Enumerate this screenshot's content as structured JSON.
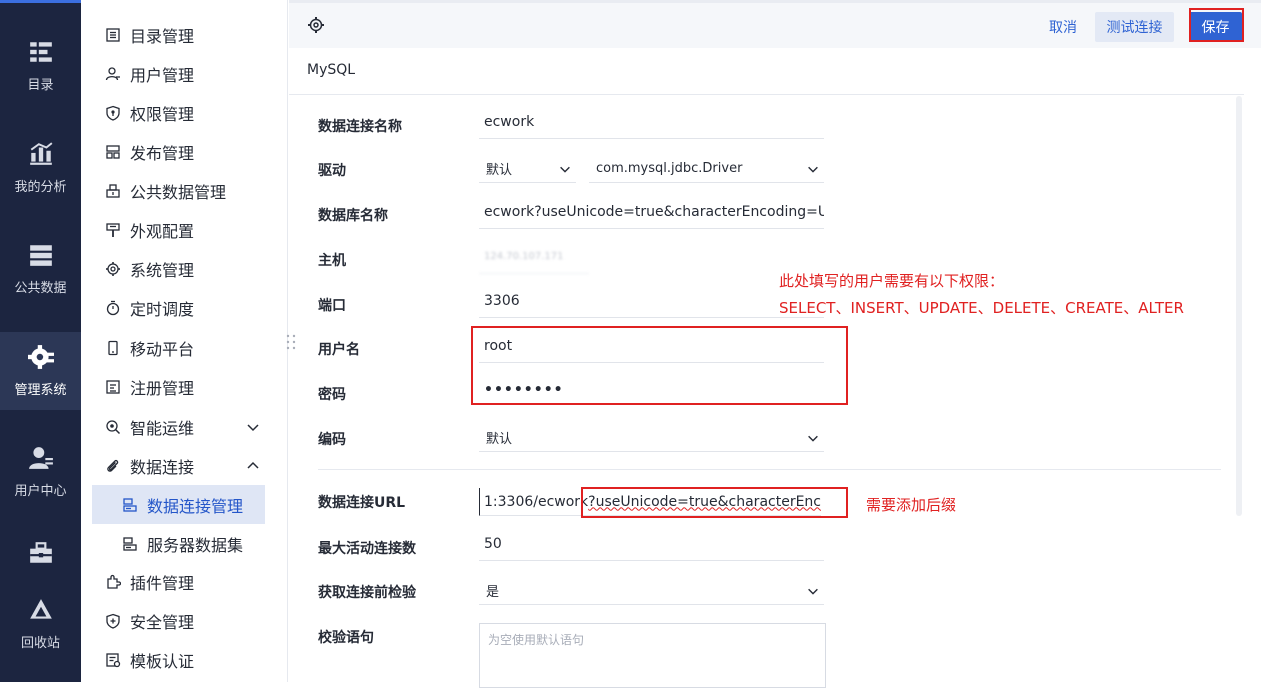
{
  "rail": {
    "items": [
      {
        "label": "目录",
        "icon": "catalog-icon"
      },
      {
        "label": "我的分析",
        "icon": "analysis-icon"
      },
      {
        "label": "公共数据",
        "icon": "public-data-icon"
      },
      {
        "label": "管理系统",
        "icon": "management-gear-icon",
        "active": true
      },
      {
        "label": "用户中心",
        "icon": "user-center-icon"
      },
      {
        "label": "",
        "icon": "toolbox-icon"
      },
      {
        "label": "回收站",
        "icon": "recycle-icon"
      }
    ]
  },
  "menu": {
    "items": [
      {
        "label": "目录管理",
        "icon": "catalog-manage-icon"
      },
      {
        "label": "用户管理",
        "icon": "user-manage-icon"
      },
      {
        "label": "权限管理",
        "icon": "permission-icon"
      },
      {
        "label": "发布管理",
        "icon": "publish-icon"
      },
      {
        "label": "公共数据管理",
        "icon": "public-data-manage-icon"
      },
      {
        "label": "外观配置",
        "icon": "appearance-icon"
      },
      {
        "label": "系统管理",
        "icon": "system-gear-icon"
      },
      {
        "label": "定时调度",
        "icon": "timer-icon"
      },
      {
        "label": "移动平台",
        "icon": "mobile-icon"
      },
      {
        "label": "注册管理",
        "icon": "register-icon"
      },
      {
        "label": "智能运维",
        "icon": "ops-icon",
        "expand": "down"
      },
      {
        "label": "数据连接",
        "icon": "link-icon",
        "expand": "up"
      },
      {
        "label": "插件管理",
        "icon": "plugin-icon"
      },
      {
        "label": "安全管理",
        "icon": "security-icon"
      },
      {
        "label": "模板认证",
        "icon": "template-icon"
      }
    ],
    "sub_items": [
      {
        "label": "数据连接管理",
        "icon": "connection-manage-icon",
        "active": true
      },
      {
        "label": "服务器数据集",
        "icon": "server-dataset-icon"
      }
    ]
  },
  "toolbar": {
    "cancel_label": "取消",
    "test_label": "测试连接",
    "save_label": "保存"
  },
  "db_type": "MySQL",
  "form": {
    "conn_name_label": "数据连接名称",
    "conn_name_value": "ecwork",
    "driver_label": "驱动",
    "driver_mode": "默认",
    "driver_class": "com.mysql.jdbc.Driver",
    "db_name_label": "数据库名称",
    "db_name_value": "ecwork?useUnicode=true&characterEncoding=U...",
    "host_label": "主机",
    "host_value": "124.70.107.171",
    "port_label": "端口",
    "port_value": "3306",
    "user_label": "用户名",
    "user_value": "root",
    "password_label": "密码",
    "password_value": "••••••••",
    "encoding_label": "编码",
    "encoding_value": "默认",
    "url_label": "数据连接URL",
    "url_prefix": "1:3306/ecwork",
    "url_suffix": "?useUnicode=true&characterEncodi",
    "max_active_label": "最大活动连接数",
    "max_active_value": "50",
    "validate_label": "获取连接前检验",
    "validate_value": "是",
    "validation_query_label": "校验语句",
    "validation_query_placeholder": "为空使用默认语句"
  },
  "annotations": {
    "permissions_line1": "此处填写的用户需要有以下权限：",
    "permissions_line2": "SELECT、INSERT、UPDATE、DELETE、CREATE、ALTER",
    "suffix_note": "需要添加后缀"
  },
  "colors": {
    "rail_bg": "#1c2540",
    "accent": "#2f63d3",
    "highlight_red": "#e02121"
  }
}
